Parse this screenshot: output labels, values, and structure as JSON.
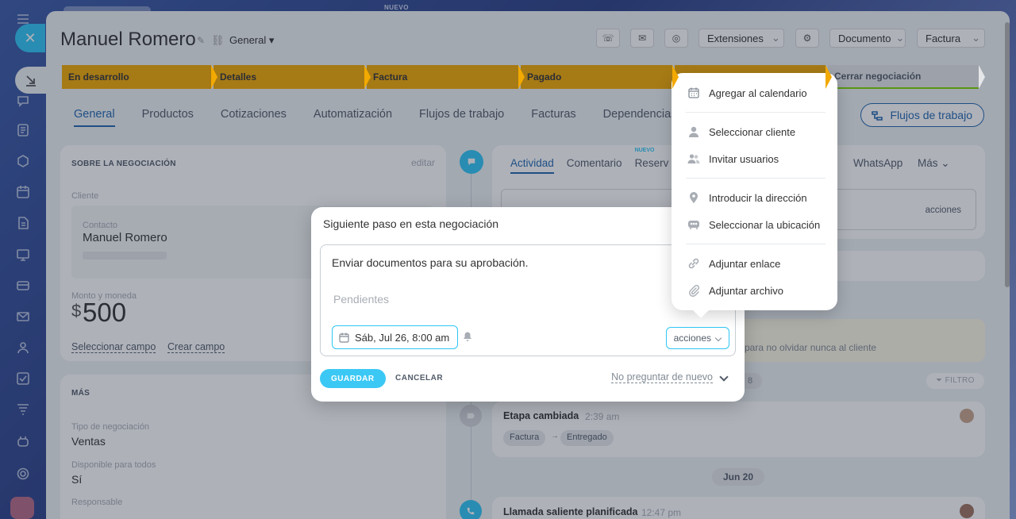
{
  "top_label": "NUEVO",
  "deal": {
    "title": "Manuel Romero",
    "pipeline": "General ▾"
  },
  "header_buttons": {
    "extensions": "Extensiones",
    "document": "Documento",
    "invoice": "Factura"
  },
  "stages": [
    {
      "label": "En desarrollo"
    },
    {
      "label": "Detalles"
    },
    {
      "label": "Factura"
    },
    {
      "label": "Pagado"
    },
    {
      "label": ""
    },
    {
      "label": "Cerrar negociación"
    }
  ],
  "tabs": [
    "General",
    "Productos",
    "Cotizaciones",
    "Automatización",
    "Flujos de trabajo",
    "Facturas",
    "Dependencias"
  ],
  "flows_button": "Flujos de trabajo",
  "about": {
    "heading": "SOBRE LA NEGOCIACIÓN",
    "edit": "editar",
    "client_label": "Cliente",
    "contact_label": "Contacto",
    "contact_name": "Manuel Romero",
    "amount_label": "Monto y moneda",
    "currency": "$",
    "amount": "500",
    "select_field": "Seleccionar campo",
    "create_field": "Crear campo"
  },
  "more": {
    "heading": "MÁS",
    "type_label": "Tipo de negociación",
    "type_value": "Ventas",
    "available_label": "Disponible para todos",
    "available_value": "Sí",
    "responsible_label": "Responsable"
  },
  "activity": {
    "tabs": [
      "Actividad",
      "Comentario",
      "Reserv"
    ],
    "new_badge": "NUEVO",
    "whatsapp": "WhatsApp",
    "more": "Más",
    "actions": "acciones",
    "reminder": "para no olvidar nunca al cliente",
    "filter": "FILTRO",
    "count": "8",
    "stage_changed": "Etapa cambiada",
    "stage_time": "2:39 am",
    "from_stage": "Factura",
    "to_stage": "Entregado",
    "date_sep": "Jun 20",
    "call_title": "Llamada saliente planificada",
    "call_time": "12:47 pm"
  },
  "modal": {
    "title": "Siguiente paso en esta negociación",
    "text": "Enviar documentos para su aprobación.",
    "placeholder": "Pendientes",
    "date": "Sáb, Jul 26, 8:00 am",
    "actions": "acciones",
    "save": "GUARDAR",
    "cancel": "CANCELAR",
    "ask": "No preguntar de nuevo"
  },
  "popup": {
    "items": [
      {
        "label": "Agregar al calendario",
        "icon": "calendar-icon"
      },
      {
        "label": "Seleccionar cliente",
        "icon": "person-icon"
      },
      {
        "label": "Invitar usuarios",
        "icon": "people-icon"
      },
      {
        "label": "Introducir la dirección",
        "icon": "location-pin-icon"
      },
      {
        "label": "Seleccionar la ubicación",
        "icon": "meeting-room-icon"
      },
      {
        "label": "Adjuntar enlace",
        "icon": "link-icon"
      },
      {
        "label": "Adjuntar archivo",
        "icon": "paperclip-icon"
      }
    ]
  },
  "colors": {
    "accent": "#2fc6f6",
    "stage": "#f2a900",
    "link": "#2067b0"
  }
}
